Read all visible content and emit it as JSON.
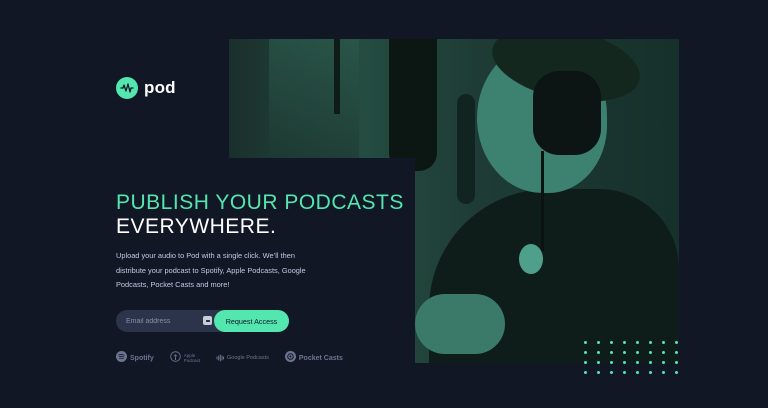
{
  "brand": {
    "name": "pod"
  },
  "hero": {
    "headline_accent": "PUBLISH YOUR PODCASTS",
    "headline_white": "EVERYWHERE.",
    "description": "Upload your audio to Pod with a single click. We’ll then distribute your podcast to Spotify, Apple Podcasts, Google Podcasts, Pocket Casts and more!"
  },
  "form": {
    "email_placeholder": "Email address",
    "submit_label": "Request Access"
  },
  "platforms": [
    {
      "name": "Spotify",
      "icon": "spotify-icon"
    },
    {
      "name": "Apple Podcast",
      "line1": "Apple",
      "line2": "Podcast",
      "icon": "apple-podcasts-icon"
    },
    {
      "name": "Google Podcasts",
      "icon": "google-podcasts-icon"
    },
    {
      "name": "Pocket Casts",
      "icon": "pocket-casts-icon"
    }
  ],
  "colors": {
    "background": "#121725",
    "accent": "#54e6af",
    "text_muted": "#c2cbe5",
    "input_bg": "#2c344b",
    "logo_gray": "#6c7590"
  }
}
